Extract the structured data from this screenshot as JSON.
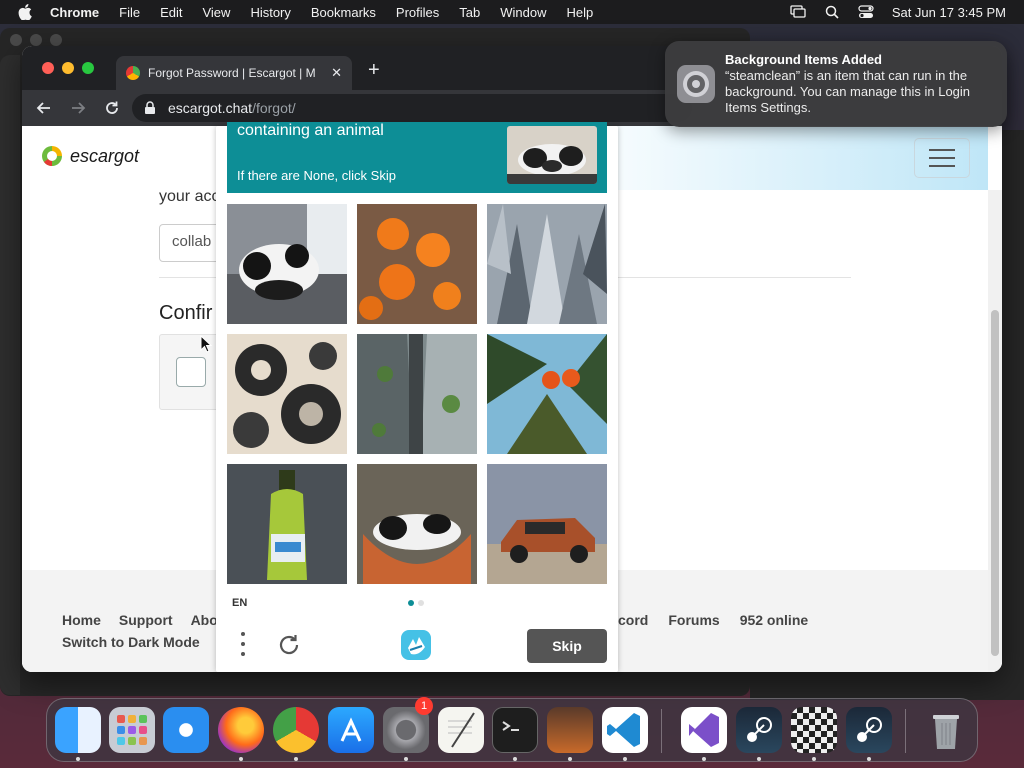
{
  "menubar": {
    "app_name": "Chrome",
    "items": [
      "File",
      "Edit",
      "View",
      "History",
      "Bookmarks",
      "Profiles",
      "Tab",
      "Window",
      "Help"
    ],
    "datetime": "Sat Jun 17  3:45 PM"
  },
  "browser": {
    "tab_title": "Forgot Password | Escargot | M",
    "url_domain": "escargot.chat",
    "url_path": "/forgot/"
  },
  "page": {
    "logo_text": "escargot",
    "account_text": "your acc",
    "field_value": "collab",
    "confirm_heading": "Confir",
    "footer_links": [
      "Home",
      "Support",
      "Abo"
    ],
    "footer_right_links": [
      "cord",
      "Forums",
      "952 online"
    ],
    "footer_dark_mode": "Switch to Dark Mode"
  },
  "captcha": {
    "prompt": "containing an animal",
    "hint": "If there are None, click Skip",
    "language": "EN",
    "skip_label": "Skip",
    "tiles": [
      "panda-on-sofa",
      "oranges",
      "city-aerial",
      "gears",
      "city-street-aerial",
      "orange-tree",
      "green-bottle",
      "panda-in-bowl",
      "orange-car"
    ]
  },
  "notification": {
    "title": "Background Items Added",
    "body": "“steamclean” is an item that can run in the background. You can manage this in Login Items Settings."
  },
  "dock": {
    "settings_badge": "1"
  },
  "colors": {
    "captcha_teal": "#0d8e96",
    "skip_button": "#555555",
    "hero_gradient_end": "#bfe6f7"
  }
}
